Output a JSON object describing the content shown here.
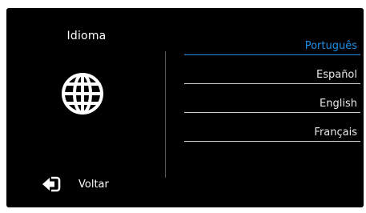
{
  "screen": {
    "title": "Idioma",
    "icon": "globe-icon",
    "back": {
      "icon": "back-arrow-icon",
      "label": "Voltar"
    },
    "languages": [
      {
        "label": "Português",
        "selected": true
      },
      {
        "label": "Español",
        "selected": false
      },
      {
        "label": "English",
        "selected": false
      },
      {
        "label": "Français",
        "selected": false
      }
    ],
    "colors": {
      "background": "#000000",
      "accent": "#1e8fe6",
      "text": "#ffffff"
    }
  }
}
